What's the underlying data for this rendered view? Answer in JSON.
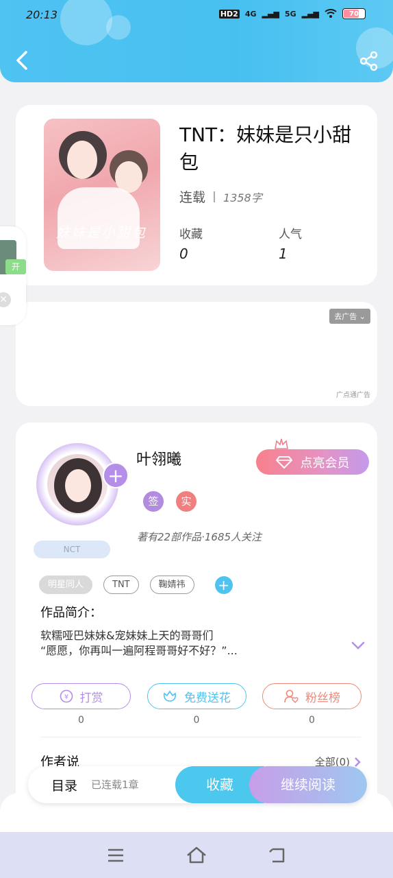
{
  "status_bar": {
    "time": "20:13",
    "network_hd": "HD2",
    "network_4g": "4G",
    "network_5g": "5G",
    "battery": "70"
  },
  "book": {
    "title": "TNT：妹妹是只小甜包",
    "status": "连载",
    "word_count": "1358字",
    "favorites_label": "收藏",
    "favorites_value": "0",
    "popularity_label": "人气",
    "popularity_value": "1",
    "cover_art_text": "妹妹是小甜包"
  },
  "side_float": {
    "open_label": "开"
  },
  "ad": {
    "remove_label": "去广告",
    "source_label": "广点通广告"
  },
  "author": {
    "name": "叶翎曦",
    "vip_button": "点亮会员",
    "badge_sign": "签",
    "badge_real": "实",
    "fan_badge": "NCT",
    "stats": "著有22部作品·1685人关注",
    "tags": [
      "明星同人",
      "TNT",
      "鞠婧祎"
    ],
    "intro_title": "作品简介：",
    "intro_lines": [
      "软糯哑巴妹妹&宠妹妹上天的哥哥们",
      "“愿愿，你再叫一遍阿程哥哥好不好？”..."
    ],
    "actions": [
      {
        "label": "打赏",
        "count": "0",
        "color": "#b48ee8",
        "icon": "coin-icon"
      },
      {
        "label": "免费送花",
        "count": "0",
        "color": "#4ec3f0",
        "icon": "flower-icon"
      },
      {
        "label": "粉丝榜",
        "count": "0",
        "color": "#f08878",
        "icon": "fans-icon"
      }
    ],
    "author_says": "作者说",
    "all_link": "全部(0)"
  },
  "bottom_bar": {
    "toc": "目录",
    "serial": "已连载1章",
    "favorite": "收藏",
    "continue_reading": "继续阅读"
  },
  "colors": {
    "header": "#4fc3f2",
    "accent_purple": "#b48ee8",
    "accent_blue": "#4cc7ee"
  }
}
